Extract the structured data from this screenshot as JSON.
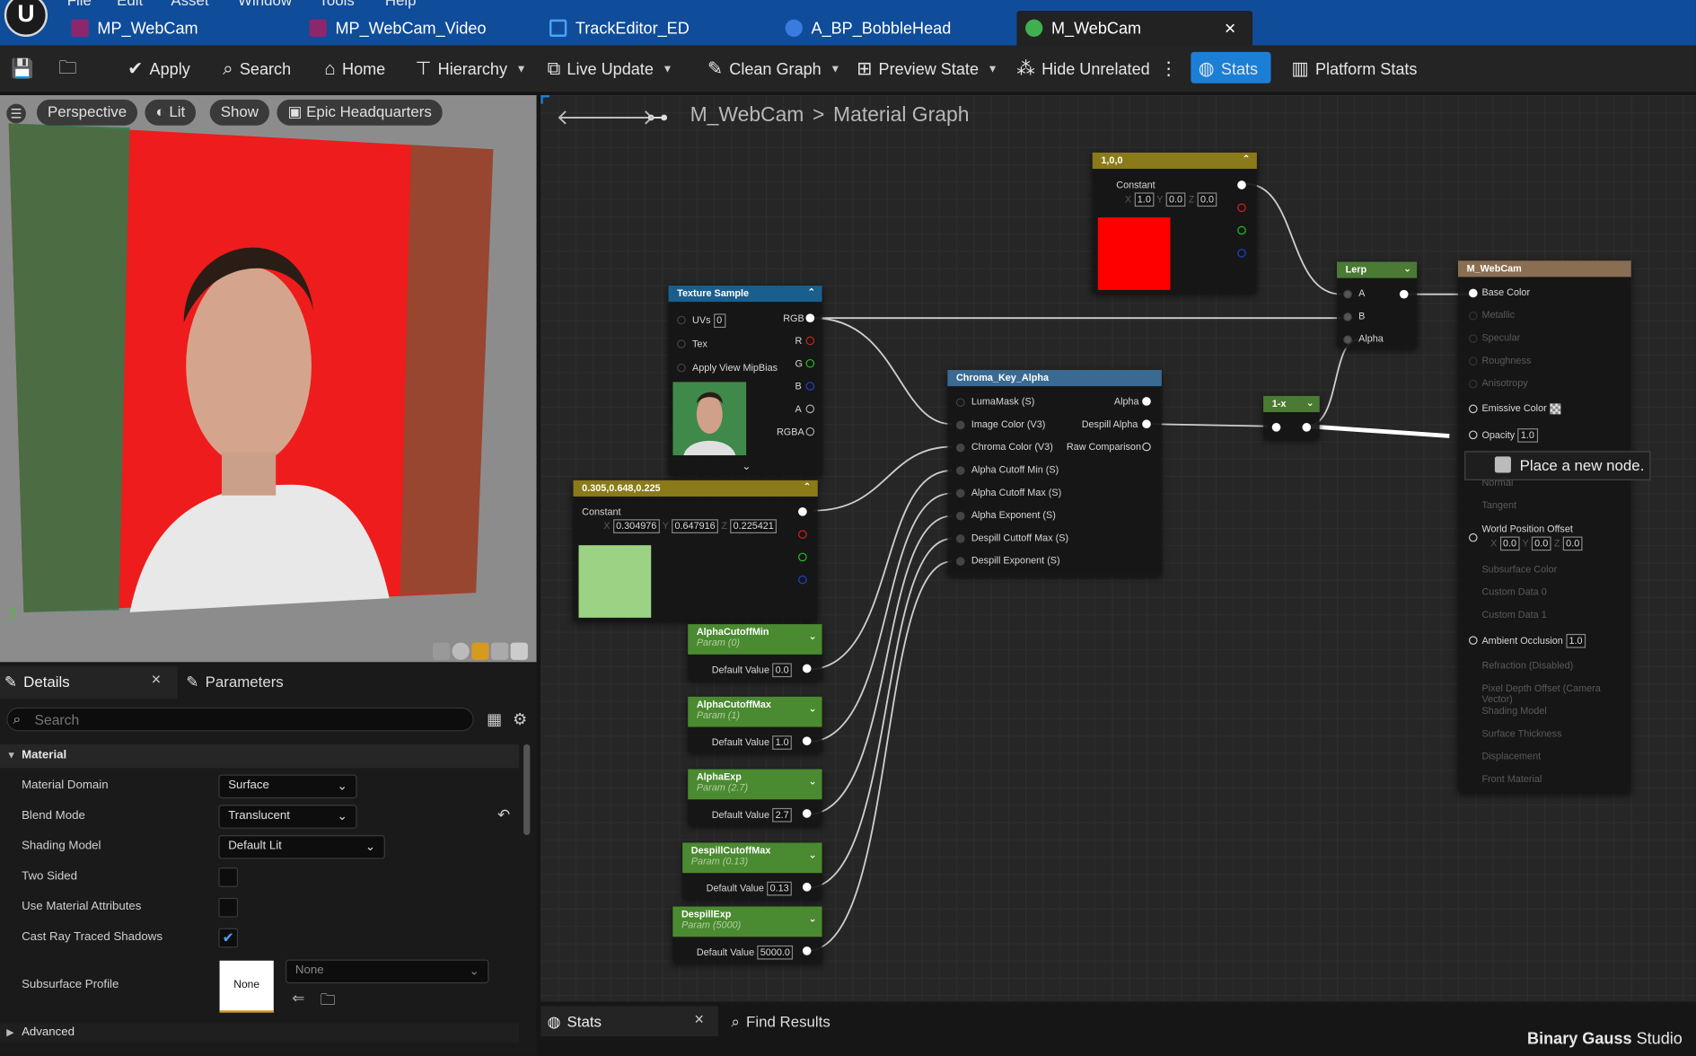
{
  "app": {
    "logo": "U",
    "menus": [
      "File",
      "Edit",
      "Asset",
      "Window",
      "Tools",
      "Help"
    ]
  },
  "tabs": [
    {
      "label": "MP_WebCam",
      "icon": "media-player-icon"
    },
    {
      "label": "MP_WebCam_Video",
      "icon": "media-player-icon"
    },
    {
      "label": "TrackEditor_ED",
      "icon": "track-editor-icon"
    },
    {
      "label": "A_BP_BobbleHead",
      "icon": "blueprint-icon"
    },
    {
      "label": "M_WebCam",
      "icon": "material-icon",
      "active": true,
      "close": "×"
    }
  ],
  "toolbar": {
    "apply": "Apply",
    "search": "Search",
    "home": "Home",
    "hierarchy": "Hierarchy",
    "live_update": "Live Update",
    "clean_graph": "Clean Graph",
    "preview_state": "Preview State",
    "hide_unrelated": "Hide Unrelated",
    "stats": "Stats",
    "platform_stats": "Platform Stats"
  },
  "viewport": {
    "perspective": "Perspective",
    "lit": "Lit",
    "show": "Show",
    "epic": "Epic Headquarters",
    "axis_z": "Z"
  },
  "details": {
    "tab_details": "Details",
    "tab_parameters": "Parameters",
    "close": "×",
    "search_placeholder": "Search",
    "section": "Material",
    "props": [
      {
        "label": "Material Domain",
        "value": "Surface"
      },
      {
        "label": "Blend Mode",
        "value": "Translucent"
      },
      {
        "label": "Shading Model",
        "value": "Default Lit"
      },
      {
        "label": "Two Sided"
      },
      {
        "label": "Use Material Attributes"
      },
      {
        "label": "Cast Ray Traced Shadows",
        "checked": true
      },
      {
        "label": "Subsurface Profile",
        "value": "None",
        "dropdown": "None"
      }
    ],
    "advanced": "Advanced"
  },
  "graph": {
    "breadcrumb_asset": "M_WebCam",
    "breadcrumb_sep": ">",
    "breadcrumb_graph": "Material Graph",
    "const_red": {
      "title": "1,0,0",
      "label": "Constant",
      "x": "1.0",
      "y": "0.0",
      "z": "0.0",
      "color": "#ff0000"
    },
    "texture": {
      "title": "Texture Sample",
      "uvs": "UVs",
      "uvs_val": "0",
      "tex": "Tex",
      "mip": "Apply View MipBias",
      "outs": [
        "RGB",
        "R",
        "G",
        "B",
        "A",
        "RGBA"
      ]
    },
    "const_green": {
      "title": "0.305,0.648,0.225",
      "label": "Constant",
      "x": "0.304976",
      "y": "0.647916",
      "z": "0.225421",
      "color": "#9bd283"
    },
    "chroma": {
      "title": "Chroma_Key_Alpha",
      "inputs": [
        "LumaMask (S)",
        "Image Color (V3)",
        "Chroma Color (V3)",
        "Alpha Cutoff Min (S)",
        "Alpha Cutoff Max (S)",
        "Alpha Exponent (S)",
        "Despill Cuttoff Max (S)",
        "Despill Exponent (S)"
      ],
      "outputs": [
        "Alpha",
        "Despill Alpha",
        "Raw Comparison"
      ]
    },
    "lerp": {
      "title": "Lerp",
      "a": "A",
      "b": "B",
      "alpha": "Alpha"
    },
    "oneminus": {
      "title": "1-x"
    },
    "params": [
      {
        "name": "AlphaCutoffMin",
        "sub": "Param (0)",
        "dv": "Default Value",
        "val": "0.0"
      },
      {
        "name": "AlphaCutoffMax",
        "sub": "Param (1)",
        "dv": "Default Value",
        "val": "1.0"
      },
      {
        "name": "AlphaExp",
        "sub": "Param (2.7)",
        "dv": "Default Value",
        "val": "2.7"
      },
      {
        "name": "DespillCutoffMax",
        "sub": "Param (0.13)",
        "dv": "Default Value",
        "val": "0.13"
      },
      {
        "name": "DespillExp",
        "sub": "Param (5000)",
        "dv": "Default Value",
        "val": "5000.0"
      }
    ],
    "result": {
      "title": "M_WebCam",
      "base": "Base Color",
      "metallic": "Metallic",
      "specular": "Specular",
      "roughness": "Roughness",
      "anisotropy": "Anisotropy",
      "emissive": "Emissive Color",
      "opacity": "Opacity",
      "opacity_val": "1.0",
      "normal": "Normal",
      "tangent": "Tangent",
      "wpo": "World Position Offset",
      "wpo_x": "0.0",
      "wpo_y": "0.0",
      "wpo_z": "0.0",
      "subsurface": "Subsurface Color",
      "cd0": "Custom Data 0",
      "cd1": "Custom Data 1",
      "ao": "Ambient Occlusion",
      "ao_val": "1.0",
      "refraction": "Refraction (Disabled)",
      "pdo": "Pixel Depth Offset (Camera Vector)",
      "shading": "Shading Model",
      "thickness": "Surface Thickness",
      "displacement": "Displacement",
      "front": "Front Material"
    },
    "tooltip": "Place a new node.",
    "xl": "X",
    "yl": "Y",
    "zl": "Z"
  },
  "bottom": {
    "stats": "Stats",
    "close": "×",
    "find": "Find Results",
    "brand_a": "Binary Gauss",
    "brand_b": " Studio"
  }
}
